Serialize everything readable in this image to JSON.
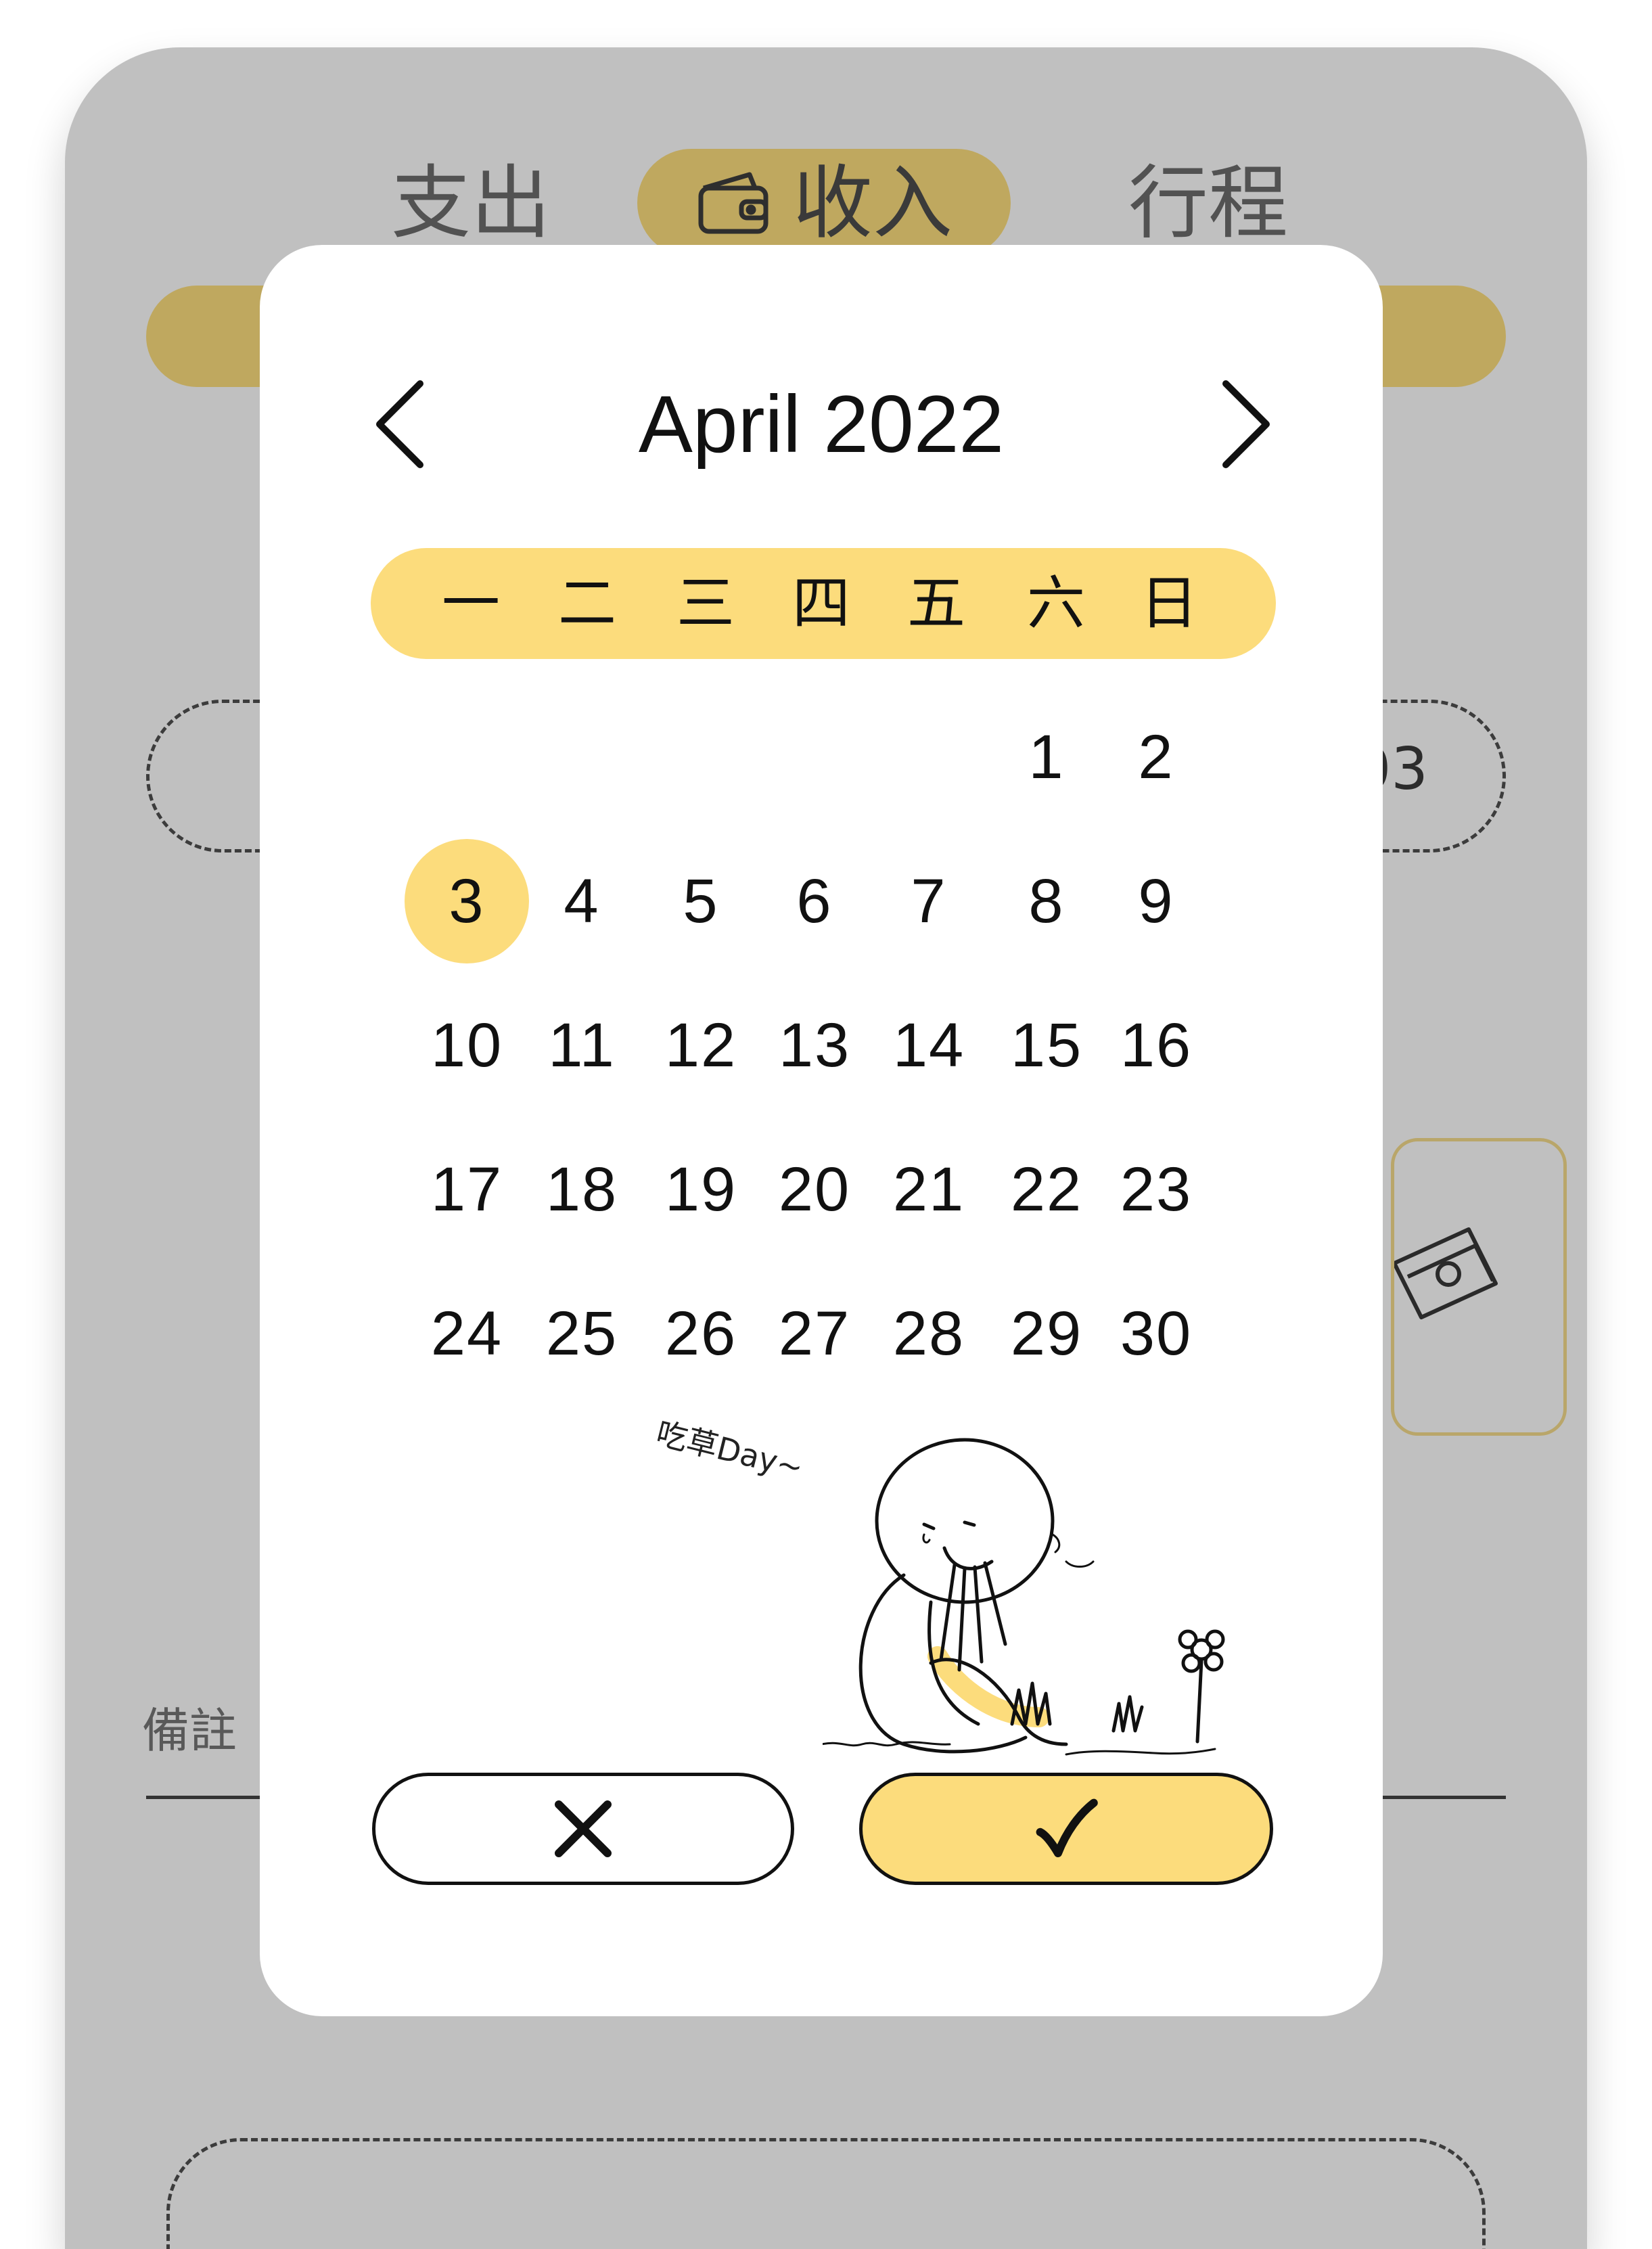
{
  "background": {
    "tabs": [
      {
        "label": "支出"
      },
      {
        "label": "收入",
        "icon": "wallet-icon",
        "active": true
      },
      {
        "label": "行程"
      }
    ],
    "date_fragment": "03",
    "note_label": "備註",
    "accent_color": "#bfa85f",
    "bg_color": "#c0c0c0"
  },
  "picker": {
    "month_title": "April 2022",
    "prev_icon": "chevron-left-icon",
    "next_icon": "chevron-right-icon",
    "weekdays": [
      "一",
      "二",
      "三",
      "四",
      "五",
      "六",
      "日"
    ],
    "first_weekday_index": 5,
    "days_in_month": 30,
    "selected_day": 3,
    "highlight_color": "#fcdc7c",
    "illustration_text": "吃草Day~",
    "cancel_icon": "close-icon",
    "confirm_icon": "checkmark-icon"
  }
}
